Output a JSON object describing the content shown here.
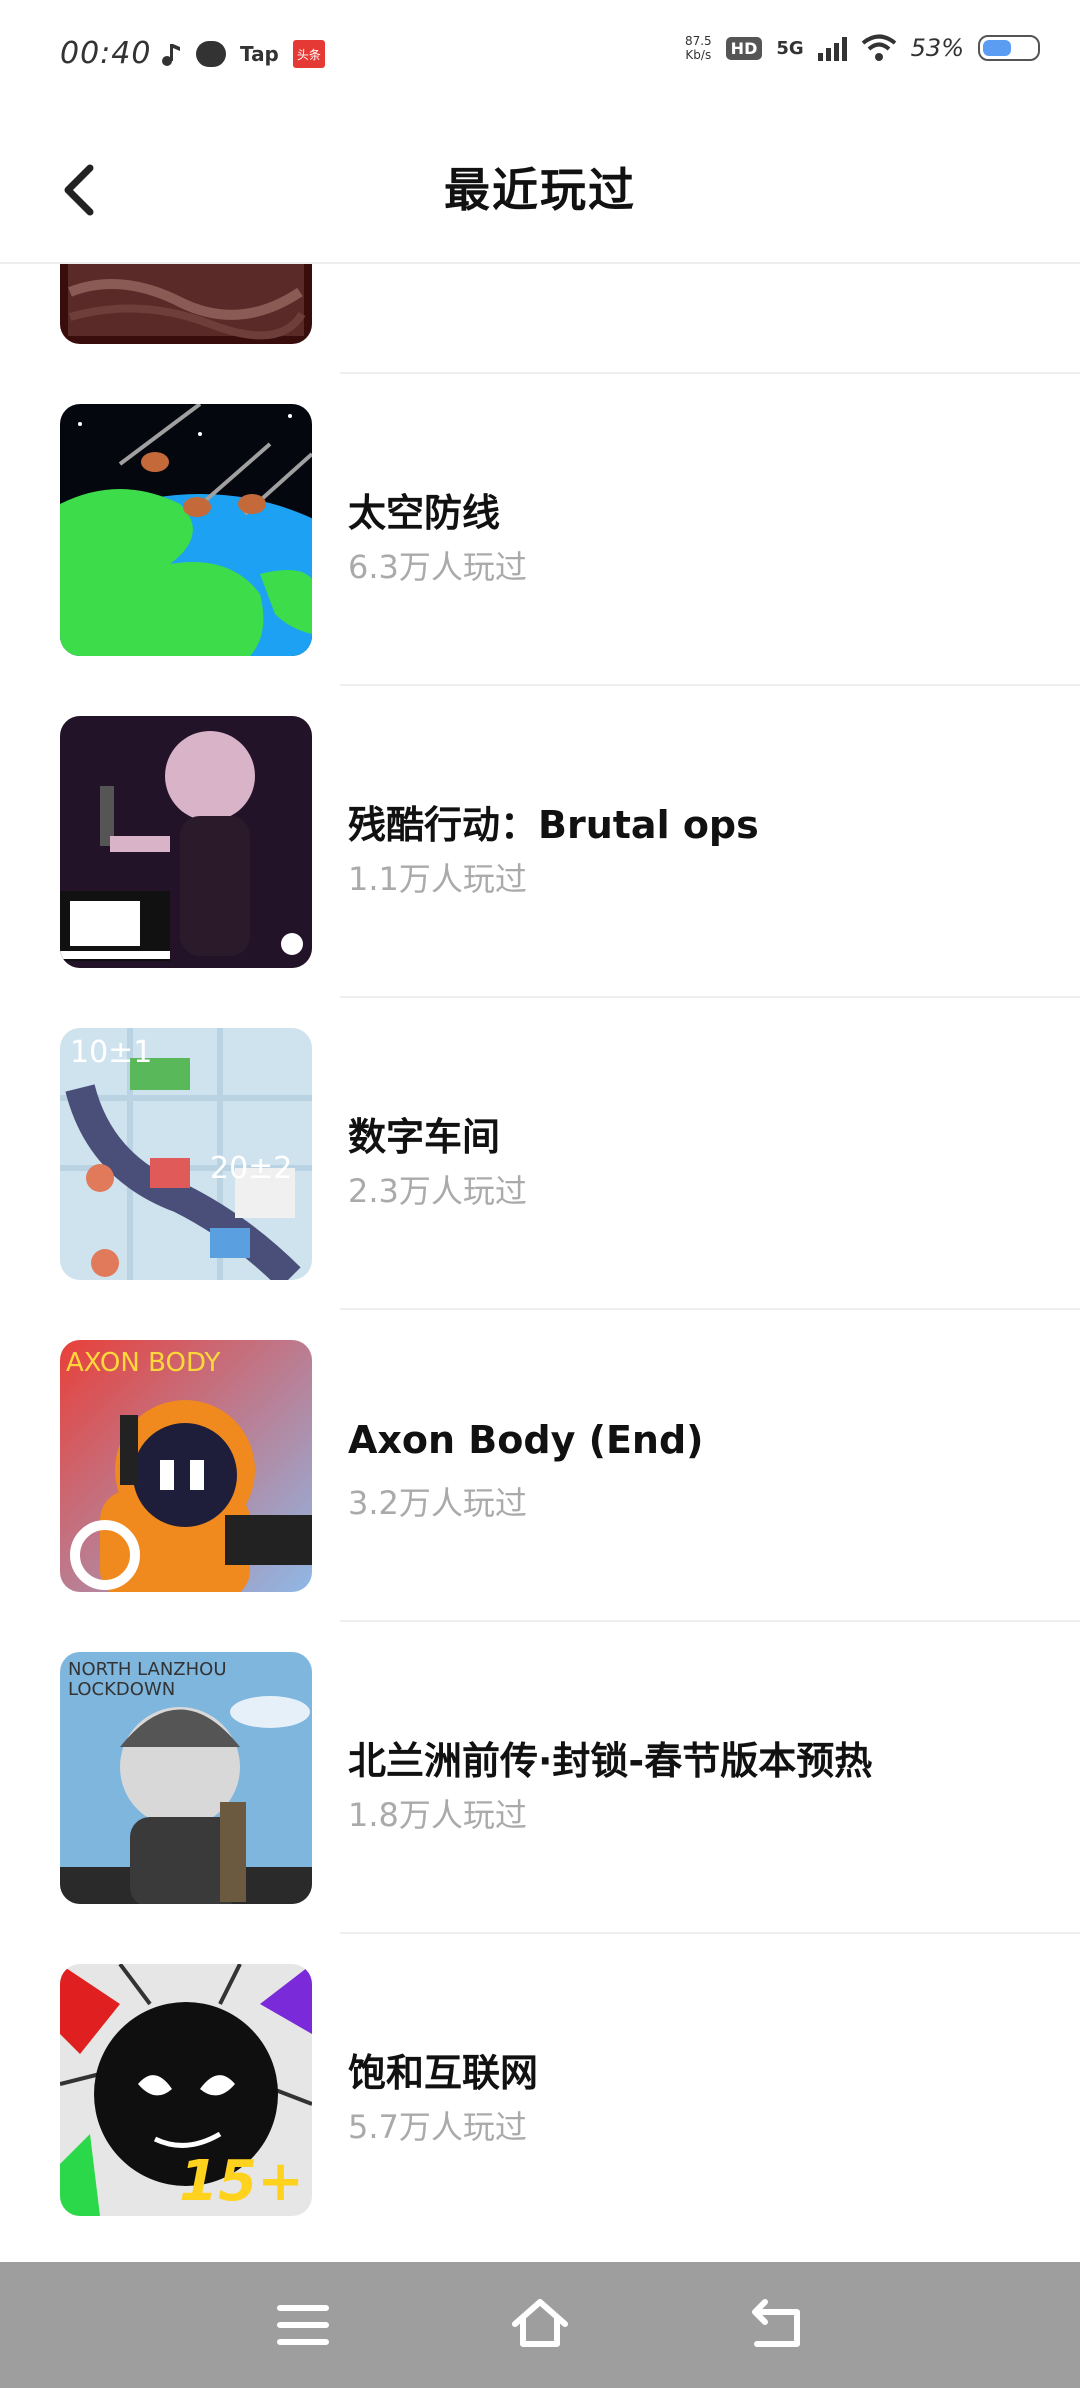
{
  "status_bar": {
    "time": "00:40",
    "icons_left": [
      "music-note-icon",
      "chat-bubble-icon",
      "taptap-icon",
      "news-app-icon"
    ],
    "tap_label": "Tap",
    "news_label": "头条",
    "net_speed_value": "87.5",
    "net_speed_unit": "Kb/s",
    "hd_label": "HD",
    "network_label": "5G",
    "battery_percent": "53%",
    "battery_level": 0.53
  },
  "app_bar": {
    "back_icon": "chevron-left-icon",
    "title": "最近玩过"
  },
  "games": [
    {
      "name": "",
      "plays": "",
      "thumb_icon": "partial-game-thumbnail"
    },
    {
      "name": "太空防线",
      "plays": "6.3万人玩过",
      "thumb_icon": "space-meteor-thumbnail"
    },
    {
      "name": "残酷行动：Brutal ops",
      "plays": "1.1万人玩过",
      "thumb_icon": "brutal-ops-thumbnail"
    },
    {
      "name": "数字车间",
      "plays": "2.3万人玩过",
      "thumb_icon": "number-workshop-thumbnail"
    },
    {
      "name": "Axon Body (End)",
      "plays": "3.2万人玩过",
      "thumb_icon": "axon-body-thumbnail",
      "thumb_text": "AXON BODY"
    },
    {
      "name": "北兰洲前传·封锁-春节版本预热",
      "plays": "1.8万人玩过",
      "thumb_icon": "north-lanzhou-thumbnail",
      "thumb_text": "NORTH LANZHOU LOCKDOWN"
    },
    {
      "name": "饱和互联网",
      "plays": "5.7万人玩过",
      "thumb_icon": "saturated-internet-thumbnail",
      "thumb_text": "15+"
    }
  ],
  "nav_bar": {
    "buttons": [
      "menu-icon",
      "home-icon",
      "back-arrow-icon"
    ]
  },
  "colors": {
    "background": "#ffffff",
    "title_text": "#111111",
    "secondary_text": "#aaaaaa",
    "divider": "#eeeeee",
    "nav_bar": "#9e9e9e",
    "battery_fill": "#5b9df2"
  }
}
